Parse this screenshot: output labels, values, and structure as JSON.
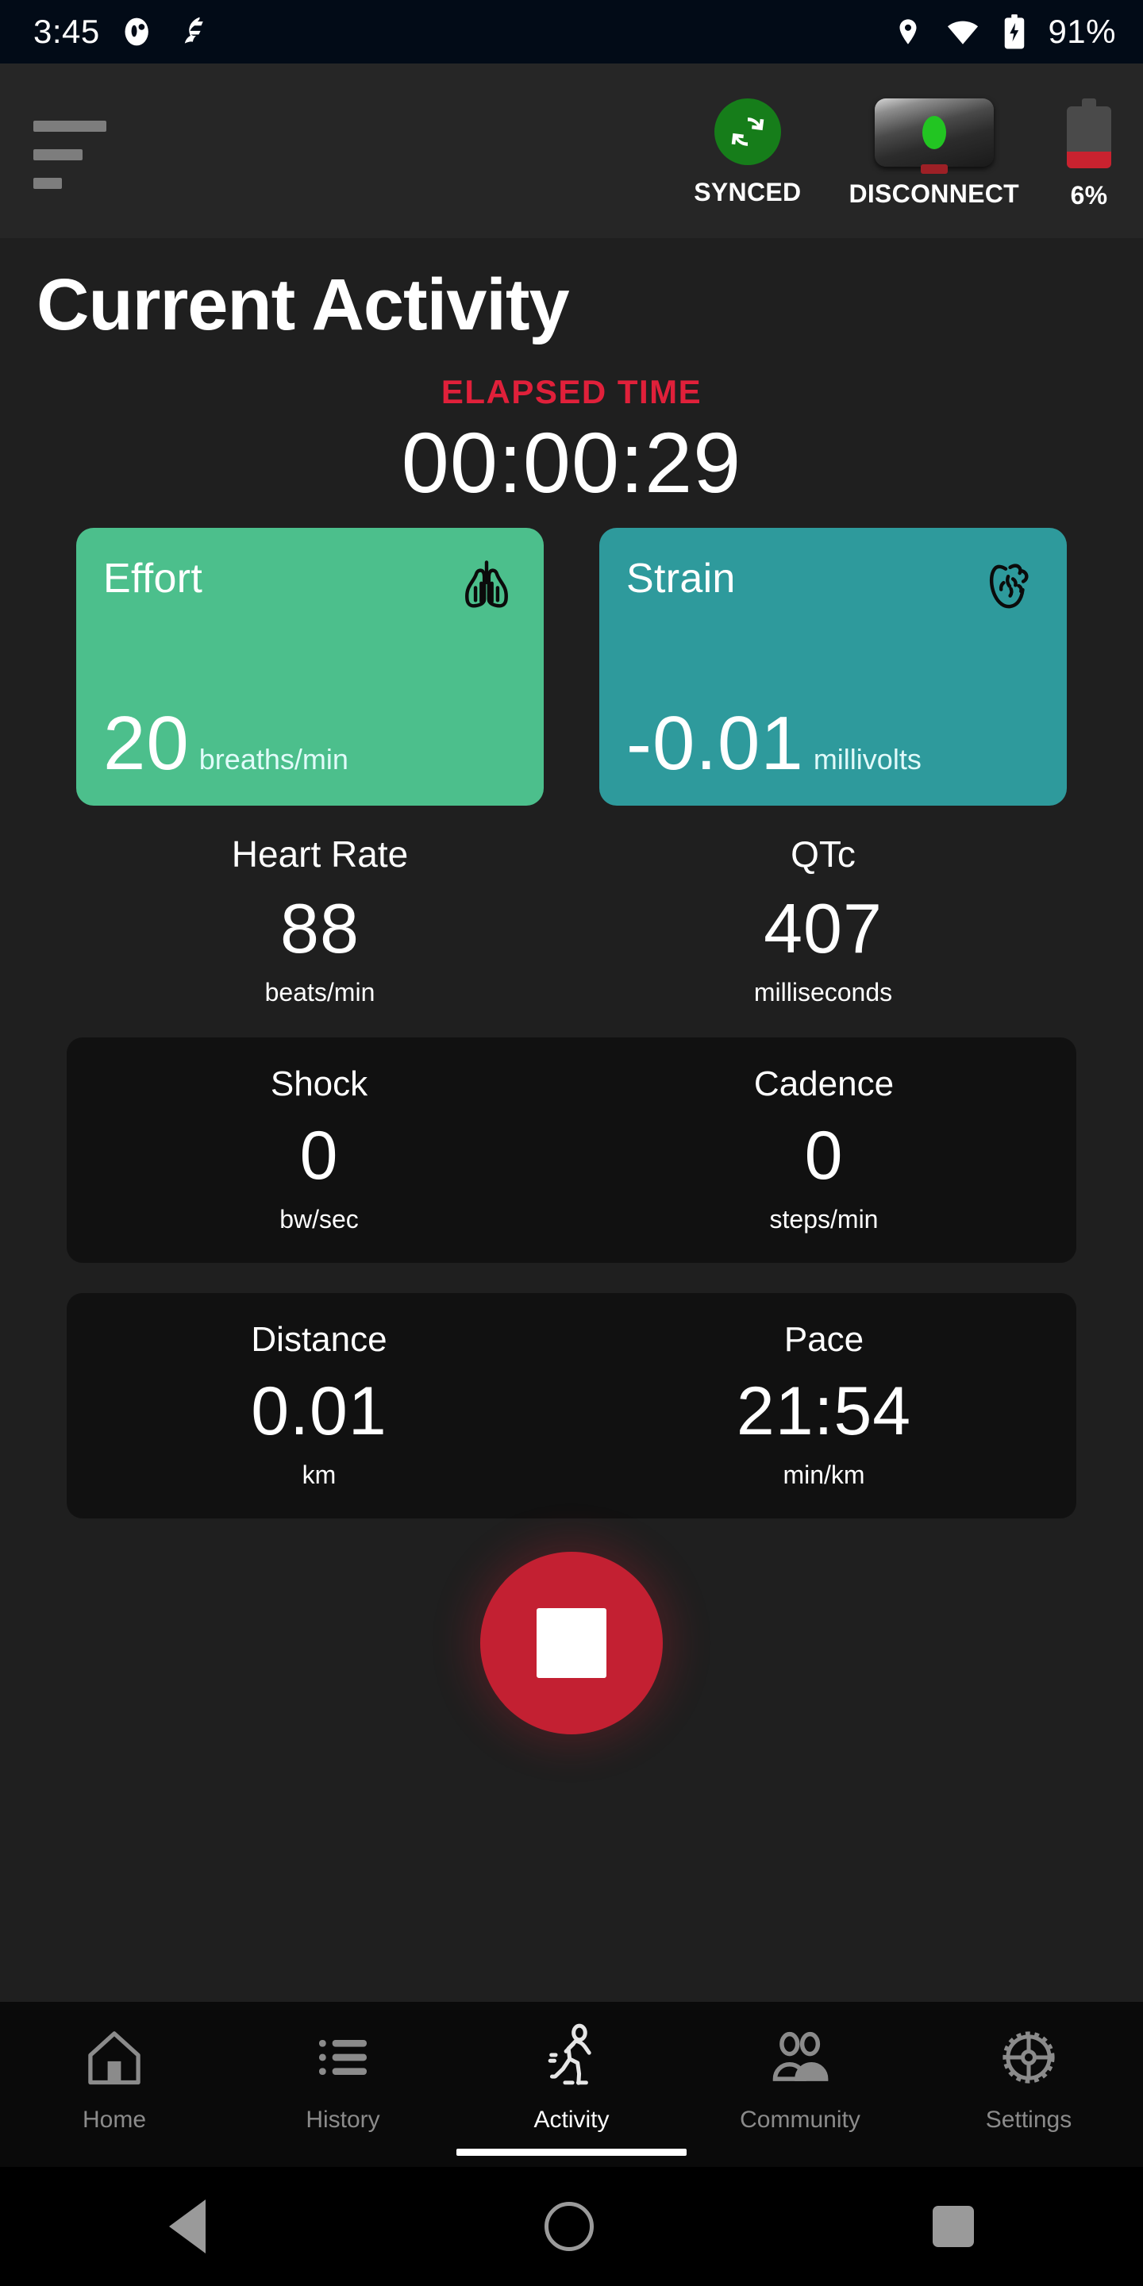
{
  "statusbar": {
    "time": "3:45",
    "battery_percent": "91%",
    "icons": [
      "ghost-app-icon",
      "fitness-app-icon",
      "location-pin-icon",
      "wifi-icon",
      "battery-charging-icon"
    ]
  },
  "appbar": {
    "menu_icon": "hamburger-menu-icon",
    "statuses": [
      {
        "label": "SYNCED",
        "icon": "sync-refresh-icon",
        "color": "#167d1a"
      },
      {
        "label": "DISCONNECT",
        "icon": "device-sensor-icon",
        "led_color": "#22c522"
      },
      {
        "label": "6%",
        "icon": "device-battery-icon",
        "fill_color": "#c9222f"
      }
    ]
  },
  "main": {
    "title": "Current Activity",
    "elapsed": {
      "label": "ELAPSED TIME",
      "value": "00:00:29",
      "label_color": "#e0203a"
    },
    "highlight_cards": [
      {
        "name": "Effort",
        "value": "20",
        "unit": "breaths/min",
        "icon": "lungs-icon",
        "bg": "#4cbf8c"
      },
      {
        "name": "Strain",
        "value": "-0.01",
        "unit": "millivolts",
        "icon": "heart-anatomical-icon",
        "bg": "#2e9a9c"
      }
    ],
    "metric_rows": [
      {
        "boxed": false,
        "cells": [
          {
            "label": "Heart Rate",
            "value": "88",
            "unit": "beats/min"
          },
          {
            "label": "QTc",
            "value": "407",
            "unit": "milliseconds"
          }
        ]
      },
      {
        "boxed": true,
        "cells": [
          {
            "label": "Shock",
            "value": "0",
            "unit": "bw/sec"
          },
          {
            "label": "Cadence",
            "value": "0",
            "unit": "steps/min"
          }
        ]
      },
      {
        "boxed": true,
        "cells": [
          {
            "label": "Distance",
            "value": "0.01",
            "unit": "km"
          },
          {
            "label": "Pace",
            "value": "21:54",
            "unit": "min/km"
          }
        ]
      }
    ],
    "stop_button": {
      "icon": "stop-square-icon",
      "color": "#c32032"
    }
  },
  "bottomnav": {
    "items": [
      {
        "label": "Home",
        "icon": "home-icon",
        "active": false
      },
      {
        "label": "History",
        "icon": "list-icon",
        "active": false
      },
      {
        "label": "Activity",
        "icon": "running-person-icon",
        "active": true
      },
      {
        "label": "Community",
        "icon": "people-icon",
        "active": false
      },
      {
        "label": "Settings",
        "icon": "gear-icon",
        "active": false
      }
    ]
  },
  "sysnav": {
    "back": "back-triangle-icon",
    "home": "home-circle-icon",
    "recents": "recents-square-icon"
  }
}
